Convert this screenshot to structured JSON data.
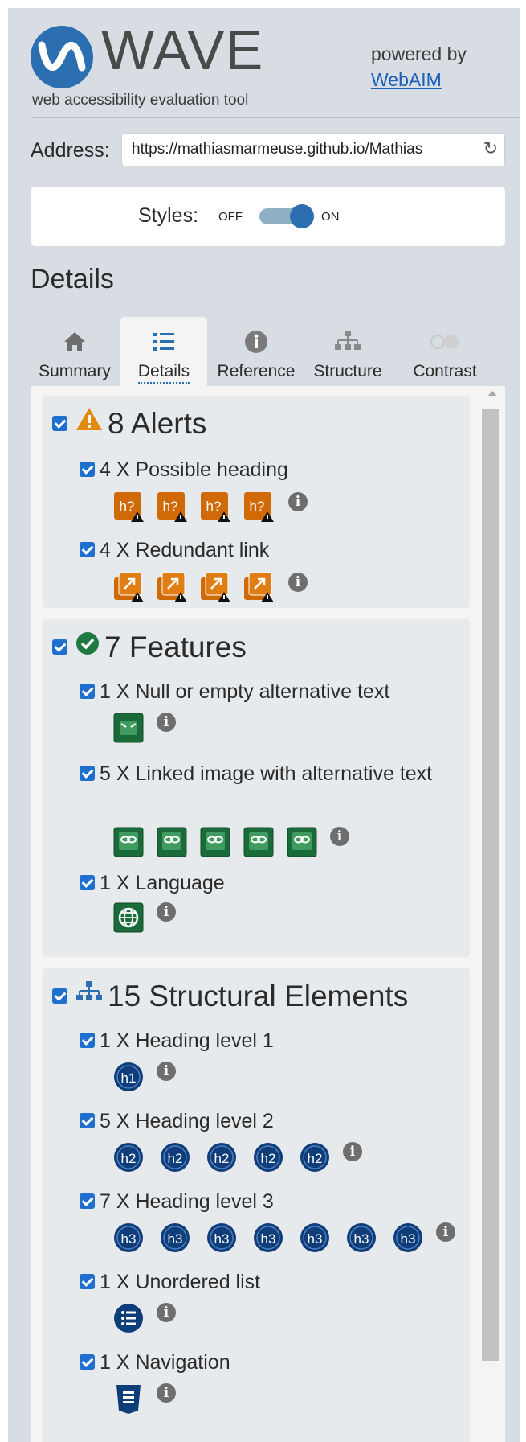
{
  "header": {
    "logo_text": "WAVE",
    "tagline": "web accessibility evaluation tool",
    "powered_by": "powered by",
    "webaim_link": "WebAIM"
  },
  "address": {
    "label": "Address:",
    "value": "https://mathiasmarmeuse.github.io/Mathias"
  },
  "styles": {
    "label": "Styles:",
    "off": "OFF",
    "on": "ON",
    "enabled": true
  },
  "page_heading": "Details",
  "tabs": [
    {
      "label": "Summary",
      "icon": "home-icon",
      "active": false
    },
    {
      "label": "Details",
      "icon": "list-icon",
      "active": true
    },
    {
      "label": "Reference",
      "icon": "info-icon",
      "active": false
    },
    {
      "label": "Structure",
      "icon": "structure-icon",
      "active": false
    },
    {
      "label": "Contrast",
      "icon": "contrast-icon",
      "active": false
    }
  ],
  "categories": {
    "alerts": {
      "title": "8 Alerts",
      "items": [
        {
          "label": "4 X Possible heading",
          "count": 4,
          "icon": "possible-heading-icon",
          "icon_text": "h?"
        },
        {
          "label": "4 X Redundant link",
          "count": 4,
          "icon": "redundant-link-icon"
        }
      ]
    },
    "features": {
      "title": "7 Features",
      "items": [
        {
          "label": "1 X Null or empty alternative text",
          "count": 1,
          "icon": "null-alt-icon"
        },
        {
          "label": "5 X Linked image with alternative text",
          "count": 5,
          "icon": "linked-image-icon"
        },
        {
          "label": "1 X Language",
          "count": 1,
          "icon": "language-icon"
        }
      ]
    },
    "structure": {
      "title": "15 Structural Elements",
      "items": [
        {
          "label": "1 X Heading level 1",
          "count": 1,
          "icon": "h1-icon",
          "icon_text": "h1"
        },
        {
          "label": "5 X Heading level 2",
          "count": 5,
          "icon": "h2-icon",
          "icon_text": "h2"
        },
        {
          "label": "7 X Heading level 3",
          "count": 7,
          "icon": "h3-icon",
          "icon_text": "h3"
        },
        {
          "label": "1 X Unordered list",
          "count": 1,
          "icon": "unordered-list-icon"
        },
        {
          "label": "1 X Navigation",
          "count": 1,
          "icon": "navigation-icon"
        }
      ]
    }
  },
  "colors": {
    "background": "#d7dde2",
    "brand_blue": "#2c6fb1",
    "alert_orange": "#d96f06",
    "feature_green": "#1b6b3a",
    "structure_navy": "#123e7a",
    "checkbox_blue": "#1e6fce"
  }
}
